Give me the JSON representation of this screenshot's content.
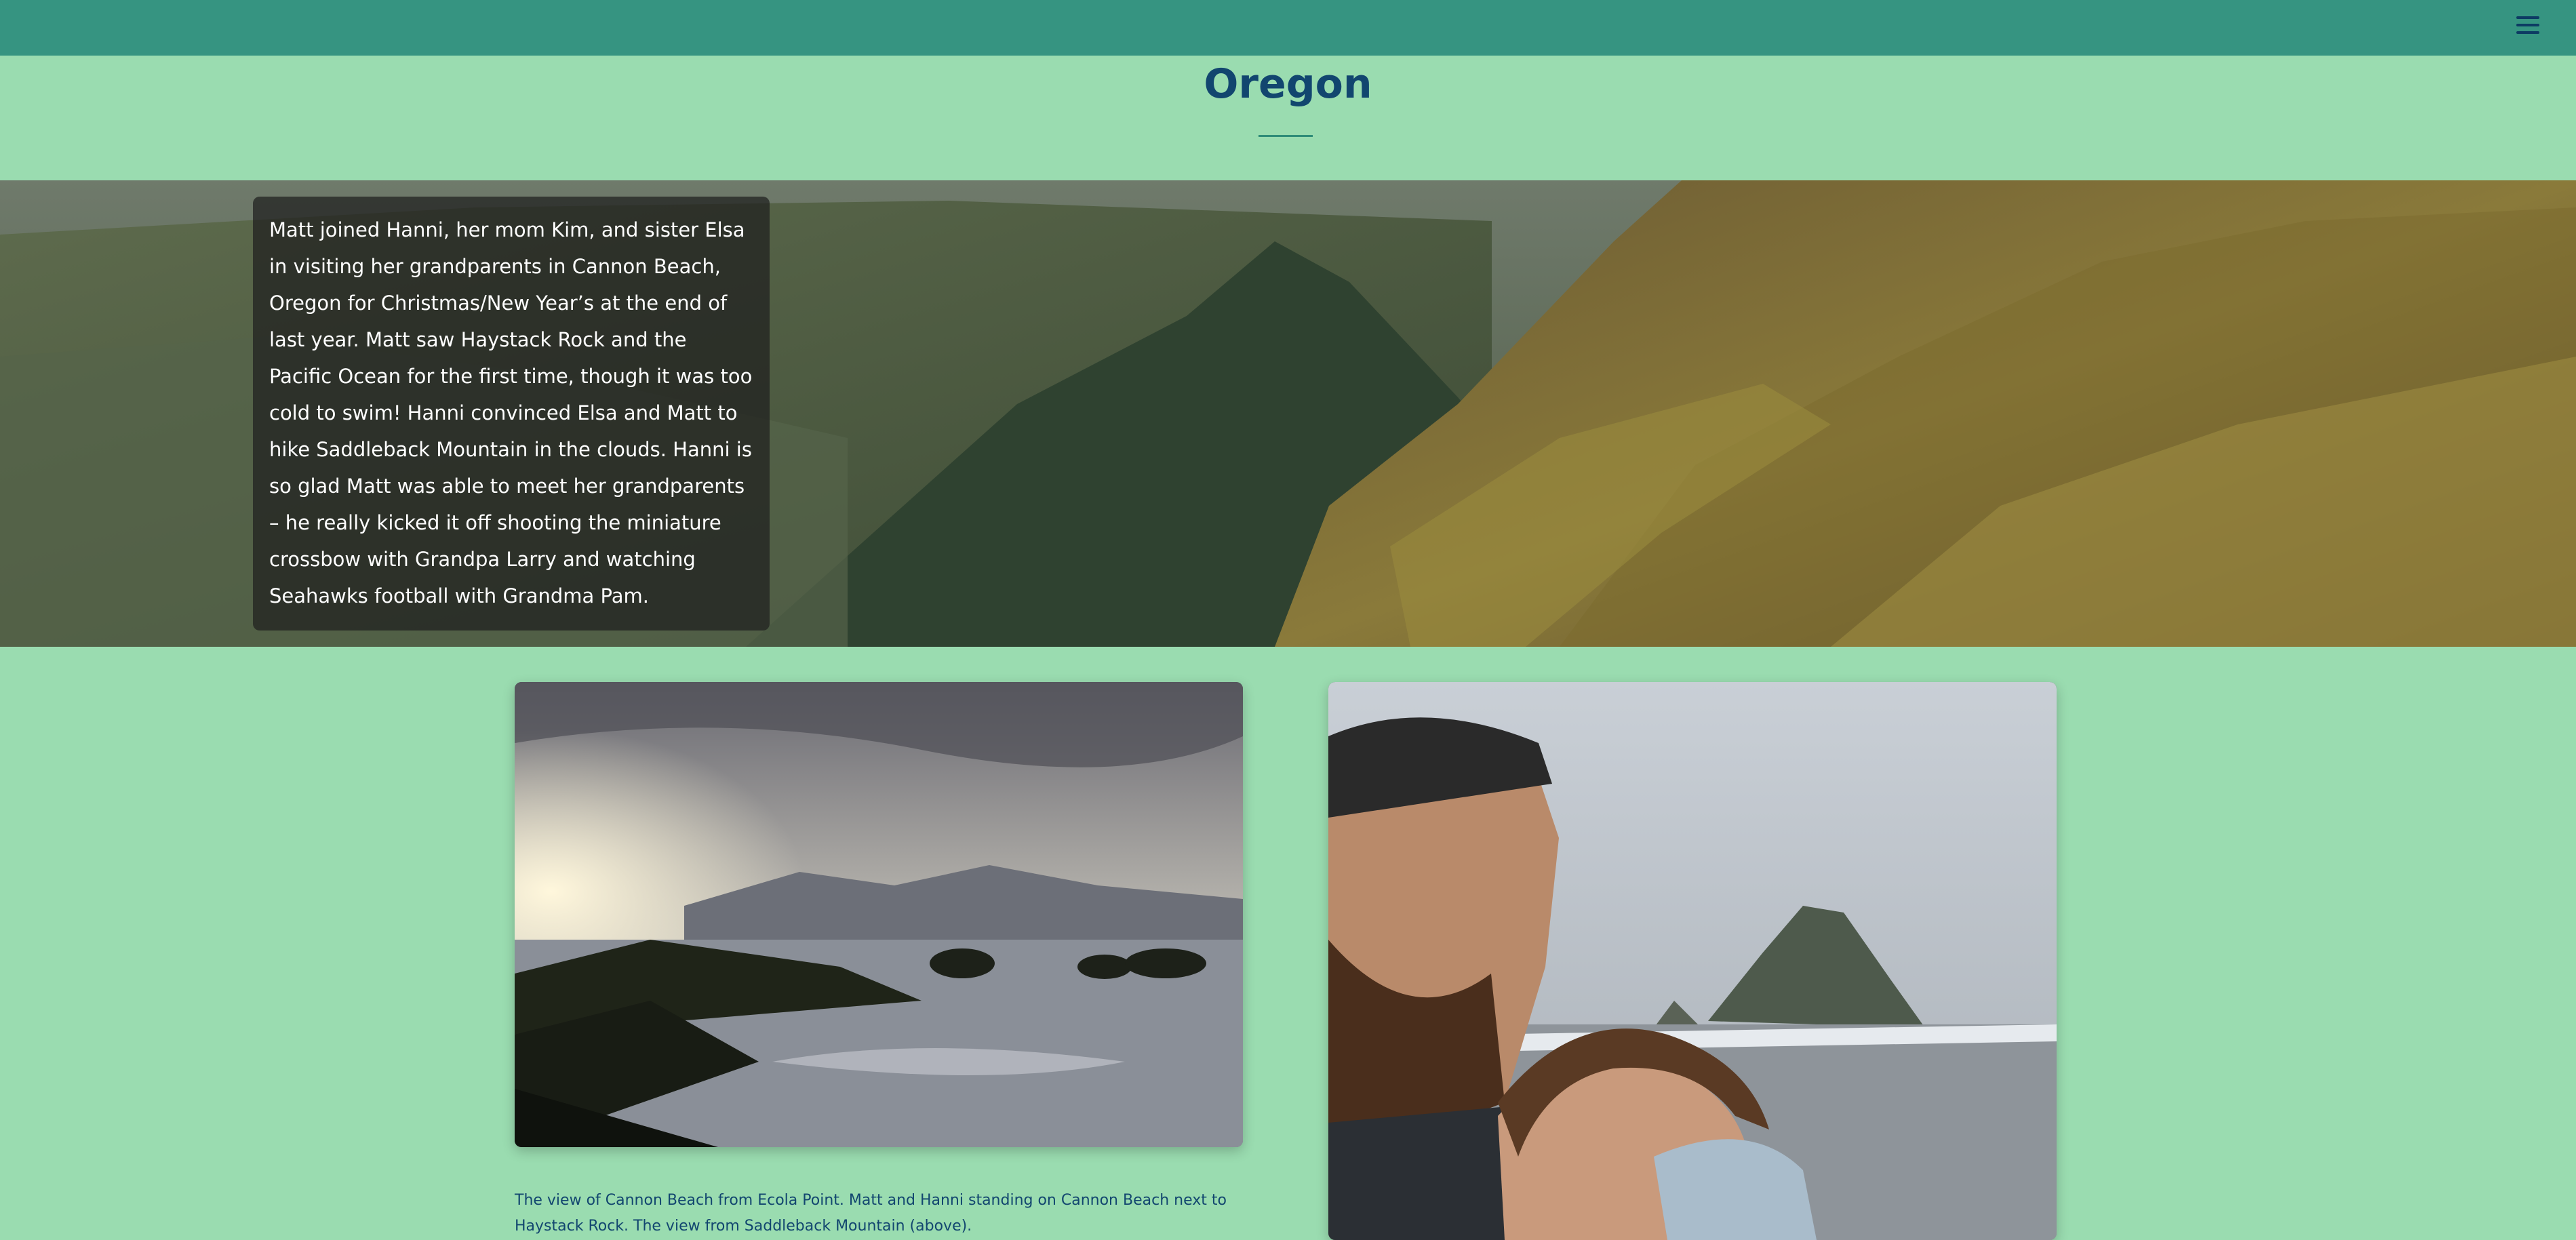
{
  "nav": {
    "menu_icon": "hamburger-menu-icon"
  },
  "page": {
    "title": "Oregon"
  },
  "hero": {
    "image": "moss-covered-cliff-over-forested-valley",
    "story": "Matt joined Hanni, her mom Kim, and sister Elsa in visiting her grandparents in Cannon Beach, Oregon for Christmas/New Year’s at the end of last year. Matt saw Haystack Rock and the Pacific Ocean for the first time, though it was too cold to swim! Hanni convinced Elsa and Matt to hike Saddleback Mountain in the clouds. Hanni is so glad Matt was able to meet her grandparents – he really kicked it off shooting the miniature crossbow with Grandpa Larry and watching Seahawks football with Grandma Pam."
  },
  "gallery": {
    "photos": [
      {
        "image": "cannon-beach-from-ecola-point"
      },
      {
        "image": "matt-and-hanni-selfie-haystack-rock"
      }
    ],
    "caption": "The view of Cannon Beach from Ecola Point. Matt and Hanni standing on Cannon Beach next to Haystack Rock. The view from Saddleback Mountain (above)."
  },
  "colors": {
    "background": "#9adcb0",
    "navbar": "#369481",
    "title": "#12466f",
    "accent": "#2f8c78"
  }
}
